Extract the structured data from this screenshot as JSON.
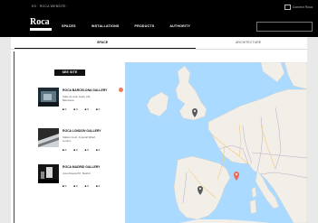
{
  "topbar": {
    "left_text": "ES  ·  ROCA WEBSITE  ·",
    "right_text": "Connect Roca"
  },
  "navbar": {
    "logo": "Roca",
    "logo_tag": "THE BATHROOM COMPANY",
    "items": [
      "SPACES",
      "INSTALLATIONS",
      "PRODUCTS",
      "AUTHORITY"
    ]
  },
  "tabs": {
    "active": "SPACE",
    "other": "ARCHITECTURE"
  },
  "see_button": "SEE SITE",
  "galleries": [
    {
      "title": "ROCA BARCELONA GALLERY",
      "addr1": "Calle de Joan Güell, 211,",
      "addr2": "Barcelona",
      "meta": [
        "■ 0",
        "■ 0",
        "■ 0",
        "■ 0"
      ]
    },
    {
      "title": "ROCA LONDON GALLERY",
      "addr1": "Station Court, Imperial Wharf,",
      "addr2": "London",
      "meta": [
        "■ 0",
        "■ 0",
        "■ 0",
        "■ 0"
      ]
    },
    {
      "title": "ROCA MADRID GALLERY",
      "addr1": "José Abascal 57, Madrid",
      "addr2": "",
      "meta": [
        "■ 0",
        "■ 0",
        "■ 0",
        "■ 0"
      ]
    }
  ],
  "colors": {
    "sea": "#aadaff",
    "land": "#f2efe9",
    "badge": "#f07a55"
  }
}
